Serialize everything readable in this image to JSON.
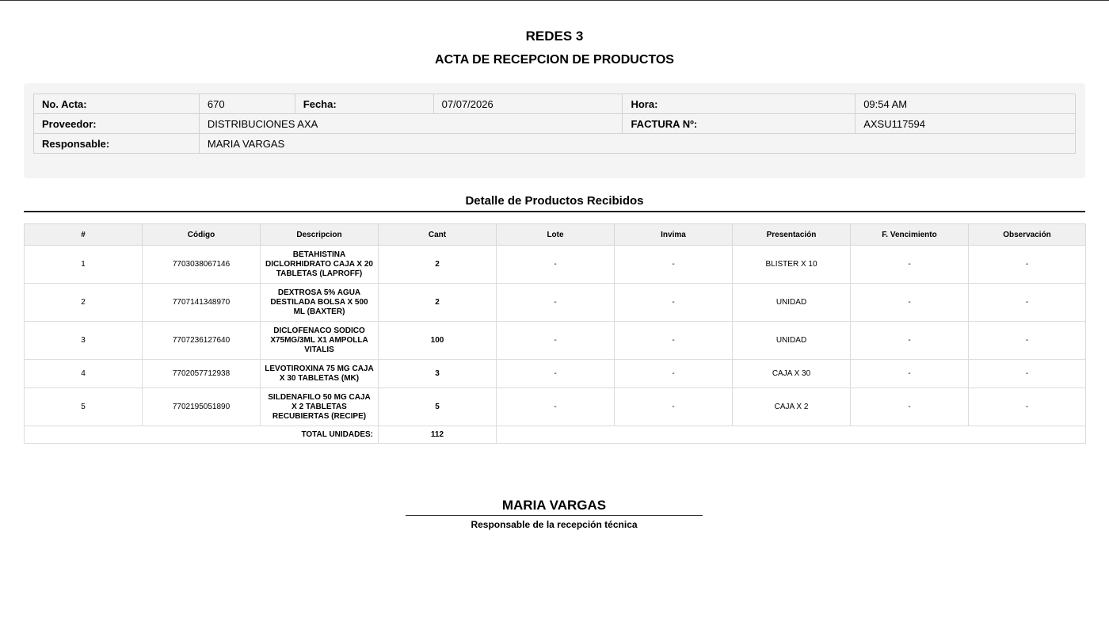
{
  "header": {
    "company": "REDES 3",
    "document_title": "ACTA DE RECEPCION DE PRODUCTOS"
  },
  "info": {
    "acta_label": "No. Acta:",
    "acta_value": "670",
    "fecha_label": "Fecha:",
    "fecha_value": "07/07/2026",
    "hora_label": "Hora:",
    "hora_value": "09:54 AM",
    "proveedor_label": "Proveedor:",
    "proveedor_value": "DISTRIBUCIONES AXA",
    "factura_label": "FACTURA Nº:",
    "factura_value": "AXSU117594",
    "responsable_label": "Responsable:",
    "responsable_value": "MARIA VARGAS"
  },
  "detail": {
    "section_title": "Detalle de Productos Recibidos",
    "columns": [
      "#",
      "Código",
      "Descripcion",
      "Cant",
      "Lote",
      "Invima",
      "Presentación",
      "F. Vencimiento",
      "Observación"
    ],
    "rows": [
      {
        "n": "1",
        "codigo": "7703038067146",
        "descripcion": "BETAHISTINA DICLORHIDRATO CAJA X 20 TABLETAS (LAPROFF)",
        "cant": "2",
        "lote": "-",
        "invima": "-",
        "presentacion": "BLISTER X 10",
        "vencimiento": "-",
        "observacion": "-"
      },
      {
        "n": "2",
        "codigo": "7707141348970",
        "descripcion": "DEXTROSA 5% AGUA DESTILADA BOLSA X 500 ML (BAXTER)",
        "cant": "2",
        "lote": "-",
        "invima": "-",
        "presentacion": "UNIDAD",
        "vencimiento": "-",
        "observacion": "-"
      },
      {
        "n": "3",
        "codigo": "7707236127640",
        "descripcion": "DICLOFENACO SODICO X75MG/3ML X1 AMPOLLA VITALIS",
        "cant": "100",
        "lote": "-",
        "invima": "-",
        "presentacion": "UNIDAD",
        "vencimiento": "-",
        "observacion": "-"
      },
      {
        "n": "4",
        "codigo": "7702057712938",
        "descripcion": "LEVOTIROXINA 75 MG CAJA X 30 TABLETAS (MK)",
        "cant": "3",
        "lote": "-",
        "invima": "-",
        "presentacion": "CAJA X 30",
        "vencimiento": "-",
        "observacion": "-"
      },
      {
        "n": "5",
        "codigo": "7702195051890",
        "descripcion": "SILDENAFILO 50 MG CAJA X 2 TABLETAS RECUBIERTAS (RECIPE)",
        "cant": "5",
        "lote": "-",
        "invima": "-",
        "presentacion": "CAJA X 2",
        "vencimiento": "-",
        "observacion": "-"
      }
    ],
    "total_label": "TOTAL UNIDADES:",
    "total_value": "112"
  },
  "signature": {
    "name": "MARIA VARGAS",
    "role": "Responsable de la recepción técnica"
  }
}
